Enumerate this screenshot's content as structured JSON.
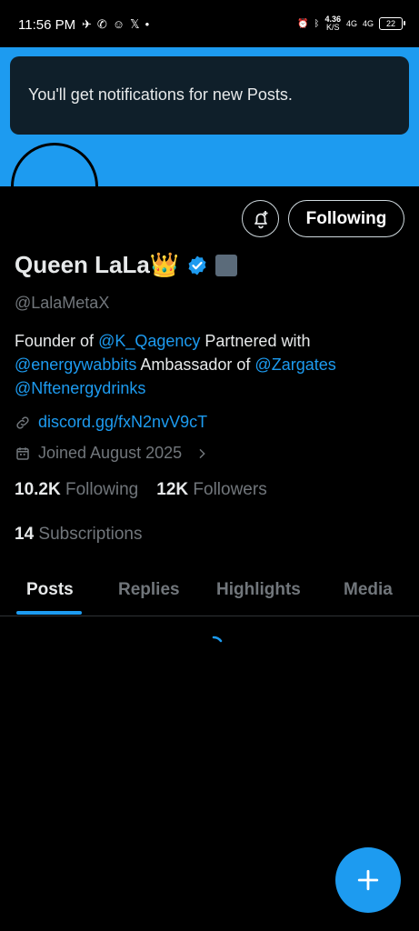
{
  "status_bar": {
    "time": "11:56 PM",
    "left_icons": [
      "telegram-icon",
      "whatsapp-icon",
      "snapchat-icon",
      "x-icon",
      "dot-icon"
    ],
    "net_speed": "4.36",
    "net_unit": "K/S",
    "signal1": "4G",
    "signal2": "4G",
    "battery": "22"
  },
  "banner": {
    "color": "#1d9bf0",
    "toast": "You'll get notifications for new Posts."
  },
  "actions": {
    "follow_label": "Following"
  },
  "profile": {
    "name": "Queen LaLa",
    "crown": "👑",
    "handle": "@LalaMetaX",
    "bio": {
      "t1": "Founder of ",
      "m1": "@K_Qagency",
      "t2": "  Partnered with ",
      "m2": "@energywabbits",
      "t3": " Ambassador of ",
      "m3": "@Zargates",
      "m4": "@Nftenergydrinks"
    },
    "link": "discord.gg/fxN2nvV9cT",
    "joined": "Joined August 2025"
  },
  "stats": {
    "following_count": "10.2K",
    "following_label": "Following",
    "followers_count": "12K",
    "followers_label": "Followers",
    "subs_count": "14",
    "subs_label": "Subscriptions"
  },
  "tabs": [
    {
      "label": "Posts"
    },
    {
      "label": "Replies"
    },
    {
      "label": "Highlights"
    },
    {
      "label": "Media"
    }
  ],
  "colors": {
    "accent": "#1d9bf0",
    "background": "#000000",
    "muted": "#71767b"
  }
}
